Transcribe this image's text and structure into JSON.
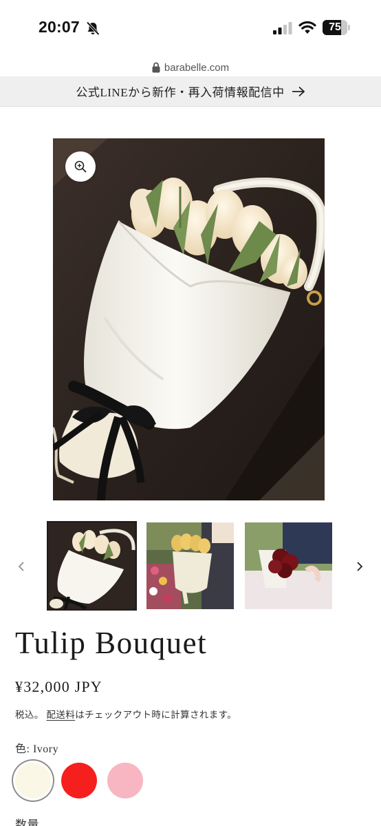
{
  "status_bar": {
    "time": "20:07",
    "battery_percent": 75,
    "battery_text": "75"
  },
  "browser": {
    "url": "barabelle.com"
  },
  "announcement": {
    "text": "公式LINEから新作・再入荷情報配信中"
  },
  "product": {
    "title": "Tulip Bouquet",
    "price": "¥32,000 JPY",
    "tax_prefix": "税込。",
    "shipping_link": "配送料",
    "tax_suffix": "はチェックアウト時に計算されます。",
    "color_label": "色: Ivory",
    "quantity_label": "数量"
  },
  "gallery": {
    "selected_index": 0,
    "thumbnail_count": 3
  },
  "swatches": [
    {
      "name": "Ivory",
      "color": "#fbf7e6",
      "selected": true
    },
    {
      "name": "Red",
      "color": "#f5201e",
      "selected": false
    },
    {
      "name": "Pink",
      "color": "#f8b5c2",
      "selected": false
    }
  ],
  "colors": {
    "announcement_bg": "#efefef",
    "text": "#1c1c1c"
  }
}
